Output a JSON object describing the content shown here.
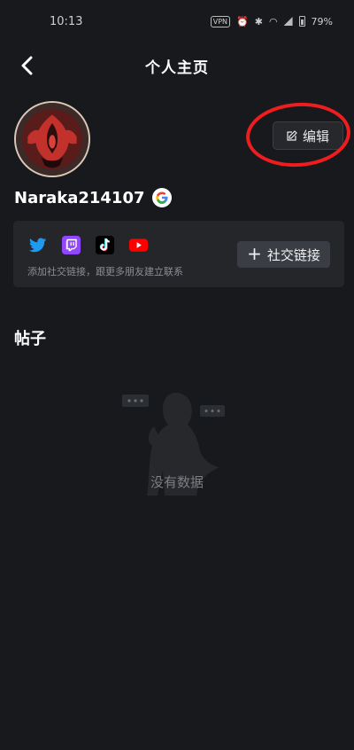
{
  "status_bar": {
    "time": "10:13",
    "vpn": "VPN",
    "battery": "79%"
  },
  "header": {
    "title": "个人主页"
  },
  "profile": {
    "username": "Naraka214107",
    "edit_label": "编辑"
  },
  "social": {
    "icons": [
      "twitter-icon",
      "twitch-icon",
      "tiktok-icon",
      "youtube-icon"
    ],
    "hint": "添加社交链接，跟更多朋友建立联系",
    "add_label": "社交链接"
  },
  "posts": {
    "title": "帖子",
    "empty_text": "没有数据"
  },
  "colors": {
    "background": "#17191c",
    "card": "#24262a",
    "annotation": "#ef1d1d"
  }
}
